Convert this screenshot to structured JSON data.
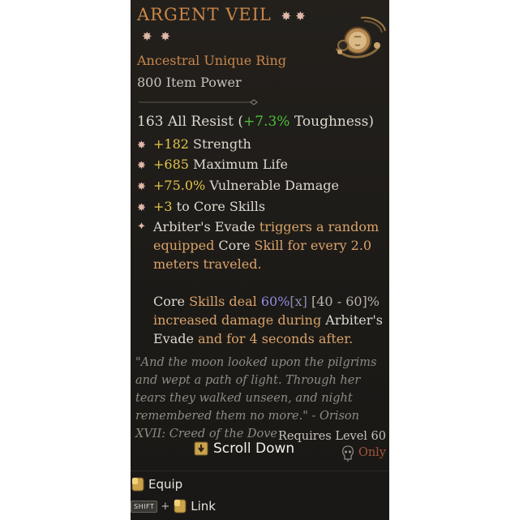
{
  "item": {
    "name": "ARGENT VEIL",
    "type": "Ancestral Unique Ring",
    "power": "800 Item Power"
  },
  "implicit": {
    "prefix": "163 All Resist (",
    "value": "+7.3%",
    "suffix": " Toughness)"
  },
  "affixes": [
    {
      "value": "+182",
      "label": " Strength"
    },
    {
      "value": "+685",
      "label": " Maximum Life"
    },
    {
      "value": "+75.0%",
      "label": " Vulnerable Damage"
    },
    {
      "value": "+3",
      "label": " to Core Skills"
    }
  ],
  "unique_power": {
    "p1": "Arbiter's Evade",
    "p2": " triggers a random equipped ",
    "p3": "Core",
    "p4": " Skill for every 2.0 meters traveled.",
    "p5": "Core",
    "p6": " Skills deal ",
    "p7": "60%",
    "p8": "[x]",
    "p9": " [40 - 60]%",
    "p10": " increased damage during ",
    "p11": "Arbiter's Evade",
    "p12": " and for 4 seconds after."
  },
  "flavor_text": "\"And the moon looked upon the pilgrims and wept a path of light. Through her tears they walked unseen, and night remembered them no more.\" - Orison XVII: Creed of the Dove",
  "requirements": {
    "level": "Requires Level 60",
    "class_only": "Only"
  },
  "prompts": {
    "scroll": "Scroll Down",
    "equip": "Equip",
    "shift_key": "SHIFT",
    "plus": "+",
    "link": "Link"
  },
  "colors": {
    "title": "#c9864a",
    "bonus_green": "#4cbf3a",
    "affix_yellow": "#e2c64a",
    "unique_gold": "#d9a36a",
    "class_only": "#a6553a"
  },
  "icons": {
    "affix_bullet": "eight-point-star",
    "unique_bullet": "four-point-star",
    "emblem": "moon-face-ring",
    "class": "necromancer-skull"
  }
}
